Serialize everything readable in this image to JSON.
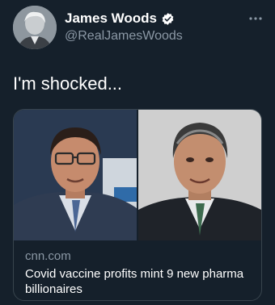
{
  "author": {
    "name": "James Woods",
    "handle": "@RealJamesWoods",
    "verified_icon": "verified-badge-icon",
    "more_icon": "more-options-icon"
  },
  "tweet": {
    "text": "I'm shocked..."
  },
  "card": {
    "domain": "cnn.com",
    "headline": "Covid vaccine profits mint 9 new pharma billionaires",
    "left_photo_alt": "Man with glasses in dark suit",
    "right_photo_alt": "Man with gray hair in suit"
  },
  "colors": {
    "background": "#15202b",
    "text_secondary": "#8b98a5",
    "card_border": "#38444d",
    "verified": "#ffffff"
  }
}
